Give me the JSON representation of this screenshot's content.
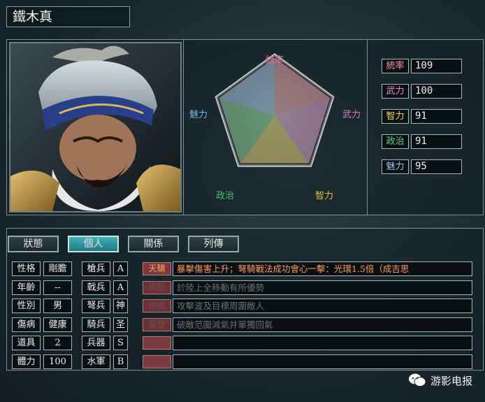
{
  "general": {
    "name": "鐵木真"
  },
  "radar": {
    "axis_labels": {
      "leadership": "統率",
      "war": "武力",
      "intellect": "智力",
      "politics": "政治",
      "charisma": "魅力"
    },
    "axis_colors": {
      "leadership": "#e07a8a",
      "war": "#d07fbf",
      "intellect": "#d9c23a",
      "politics": "#4fbf6a",
      "charisma": "#7fb0e0"
    }
  },
  "stats": [
    {
      "label": "統率",
      "value": "109",
      "color": "#ff8fa0"
    },
    {
      "label": "武力",
      "value": "100",
      "color": "#e68ad8"
    },
    {
      "label": "智力",
      "value": "91",
      "color": "#f0d84a"
    },
    {
      "label": "政治",
      "value": "91",
      "color": "#60d47a"
    },
    {
      "label": "魅力",
      "value": "95",
      "color": "#8cc4f4"
    }
  ],
  "tabs": [
    {
      "label": "狀態",
      "active": false
    },
    {
      "label": "個人",
      "active": true
    },
    {
      "label": "關係",
      "active": false
    },
    {
      "label": "列傳",
      "active": false
    }
  ],
  "personal": [
    {
      "label": "性格",
      "value": "剛膽"
    },
    {
      "label": "年齡",
      "value": "--"
    },
    {
      "label": "性別",
      "value": "男"
    },
    {
      "label": "傷病",
      "value": "健康"
    },
    {
      "label": "道具",
      "value": "2"
    },
    {
      "label": "體力",
      "value": "100"
    }
  ],
  "aptitude": [
    {
      "label": "槍兵",
      "value": "A"
    },
    {
      "label": "戟兵",
      "value": "A"
    },
    {
      "label": "弩兵",
      "value": "神"
    },
    {
      "label": "騎兵",
      "value": "圣"
    },
    {
      "label": "兵器",
      "value": "S"
    },
    {
      "label": "水軍",
      "value": "B"
    }
  ],
  "skills": [
    {
      "tag": "天驕",
      "desc": "暴擊傷害上升；弩騎戰法成功會心一擊：光環1.5倍（成吉思",
      "state": "hl"
    },
    {
      "tag": "疾馳",
      "desc": "於陸上全移動有所優勢",
      "state": "dim"
    },
    {
      "tag": "神威",
      "desc": "攻擊波及目標周圍敵人",
      "state": "dim"
    },
    {
      "tag": "蒼狼",
      "desc": "破敵范圍減氣并單獨回氣",
      "state": "dim"
    },
    {
      "tag": "",
      "desc": "",
      "state": "empty"
    },
    {
      "tag": "",
      "desc": "",
      "state": "empty"
    }
  ],
  "watermark": {
    "text": "游影电报",
    "icon": "wechat-icon"
  }
}
